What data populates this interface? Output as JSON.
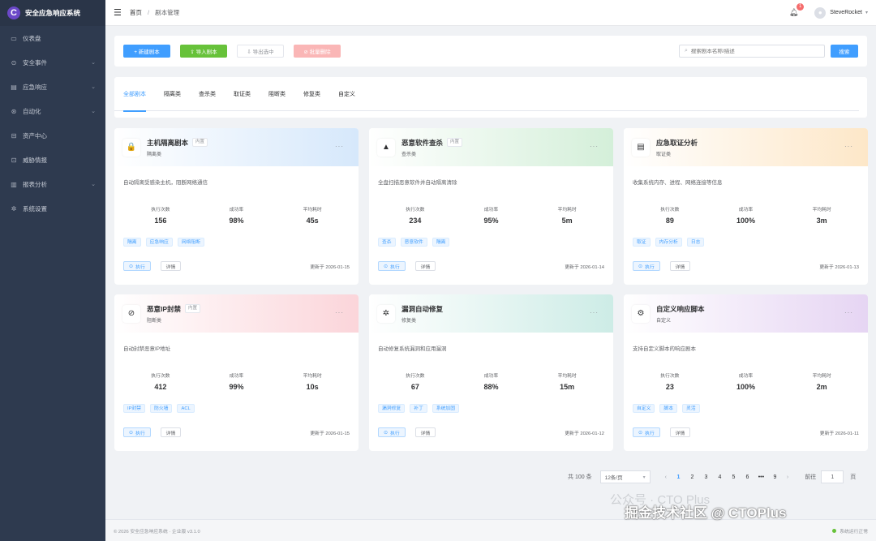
{
  "app": {
    "logo_letter": "C",
    "title": "安全应急响应系统"
  },
  "sidebar": {
    "items": [
      {
        "icon": "monitor-icon",
        "glyph": "▭",
        "label": "仪表盘",
        "chevron": false
      },
      {
        "icon": "alert-circle-icon",
        "glyph": "⊙",
        "label": "安全事件",
        "chevron": true
      },
      {
        "icon": "document-icon",
        "glyph": "▤",
        "label": "应急响应",
        "chevron": true
      },
      {
        "icon": "automation-icon",
        "glyph": "⊛",
        "label": "自动化",
        "chevron": true
      },
      {
        "icon": "database-icon",
        "glyph": "⊟",
        "label": "资产中心",
        "chevron": false
      },
      {
        "icon": "threat-intel-icon",
        "glyph": "⊡",
        "label": "威胁情报",
        "chevron": false
      },
      {
        "icon": "report-icon",
        "glyph": "▥",
        "label": "报表分析",
        "chevron": true
      },
      {
        "icon": "gear-icon",
        "glyph": "✲",
        "label": "系统设置",
        "chevron": false
      }
    ]
  },
  "topbar": {
    "breadcrumb": [
      "首页",
      "剧本管理"
    ],
    "notification_count": "1",
    "username": "SteveRocket"
  },
  "toolbar": {
    "new_label": "+ 新建剧本",
    "import_label": "⇪ 导入剧本",
    "export_label": "⇩ 导出选中",
    "batch_delete_label": "⊘ 批量删除",
    "search_placeholder": "搜索剧本名称/描述",
    "search_label": "搜索"
  },
  "tabs": [
    "全部剧本",
    "隔离类",
    "查杀类",
    "取证类",
    "阻断类",
    "修复类",
    "自定义"
  ],
  "cards": [
    {
      "icon": "lock-icon",
      "glyph": "🔒",
      "title": "主机隔离剧本",
      "tag": "内置",
      "category": "隔离类",
      "desc": "自动隔离受感染主机，阻断网络通信",
      "runs": "156",
      "success": "98%",
      "avg_time": "45s",
      "chips": [
        "隔离",
        "应急响应",
        "网络阻断"
      ],
      "updated": "更新于 2026-01-15"
    },
    {
      "icon": "warning-icon",
      "glyph": "▲",
      "title": "恶意软件查杀",
      "tag": "内置",
      "category": "查杀类",
      "desc": "全盘扫描恶意软件并自动隔离清除",
      "runs": "234",
      "success": "95%",
      "avg_time": "5m",
      "chips": [
        "查杀",
        "恶意软件",
        "隔离"
      ],
      "updated": "更新于 2026-01-14"
    },
    {
      "icon": "document-icon",
      "glyph": "▤",
      "title": "应急取证分析",
      "tag": "",
      "category": "取证类",
      "desc": "收集系统内存、进程、网络连接等信息",
      "runs": "89",
      "success": "100%",
      "avg_time": "3m",
      "chips": [
        "取证",
        "内存分析",
        "日志"
      ],
      "updated": "更新于 2026-01-13"
    },
    {
      "icon": "block-icon",
      "glyph": "⊘",
      "title": "恶意IP封禁",
      "tag": "内置",
      "category": "阻断类",
      "desc": "自动封禁恶意IP地址",
      "runs": "412",
      "success": "99%",
      "avg_time": "10s",
      "chips": [
        "IP封禁",
        "防火墙",
        "ACL"
      ],
      "updated": "更新于 2026-01-15"
    },
    {
      "icon": "gear-icon",
      "glyph": "✲",
      "title": "漏洞自动修复",
      "tag": "",
      "category": "修复类",
      "desc": "自动修复系统漏洞和应用漏洞",
      "runs": "67",
      "success": "88%",
      "avg_time": "15m",
      "chips": [
        "漏洞修复",
        "补丁",
        "系统加固"
      ],
      "updated": "更新于 2026-01-12"
    },
    {
      "icon": "settings-icon",
      "glyph": "⚙",
      "title": "自定义响应脚本",
      "tag": "",
      "category": "自定义",
      "desc": "支持自定义脚本的响应剧本",
      "runs": "23",
      "success": "100%",
      "avg_time": "2m",
      "chips": [
        "自定义",
        "脚本",
        "灵活"
      ],
      "updated": "更新于 2026-01-11"
    }
  ],
  "card_labels": {
    "runs": "执行次数",
    "success": "成功率",
    "avg_time": "平均耗时",
    "run_btn": "执行",
    "detail_btn": "详情",
    "more": "···"
  },
  "pagination": {
    "total": "共 100 条",
    "page_size": "12条/页",
    "pages": [
      "1",
      "2",
      "3",
      "4",
      "5",
      "6",
      "•••",
      "9"
    ],
    "active_page": "1",
    "goto_label": "前往",
    "goto_value": "1",
    "page_unit": "页"
  },
  "footer": {
    "copyright": "© 2026 安全应急响应系统 · 企业版 v3.1.0",
    "status": "系统运行正常"
  },
  "watermark": {
    "public_account": "公众号 · CTO Plus",
    "credit": "掘金技术社区 @ CTOPlus"
  },
  "colors": {
    "primary": "#409eff",
    "success": "#67c23a",
    "danger": "#f56c6c",
    "sidebar_bg": "#2e3a4f"
  }
}
